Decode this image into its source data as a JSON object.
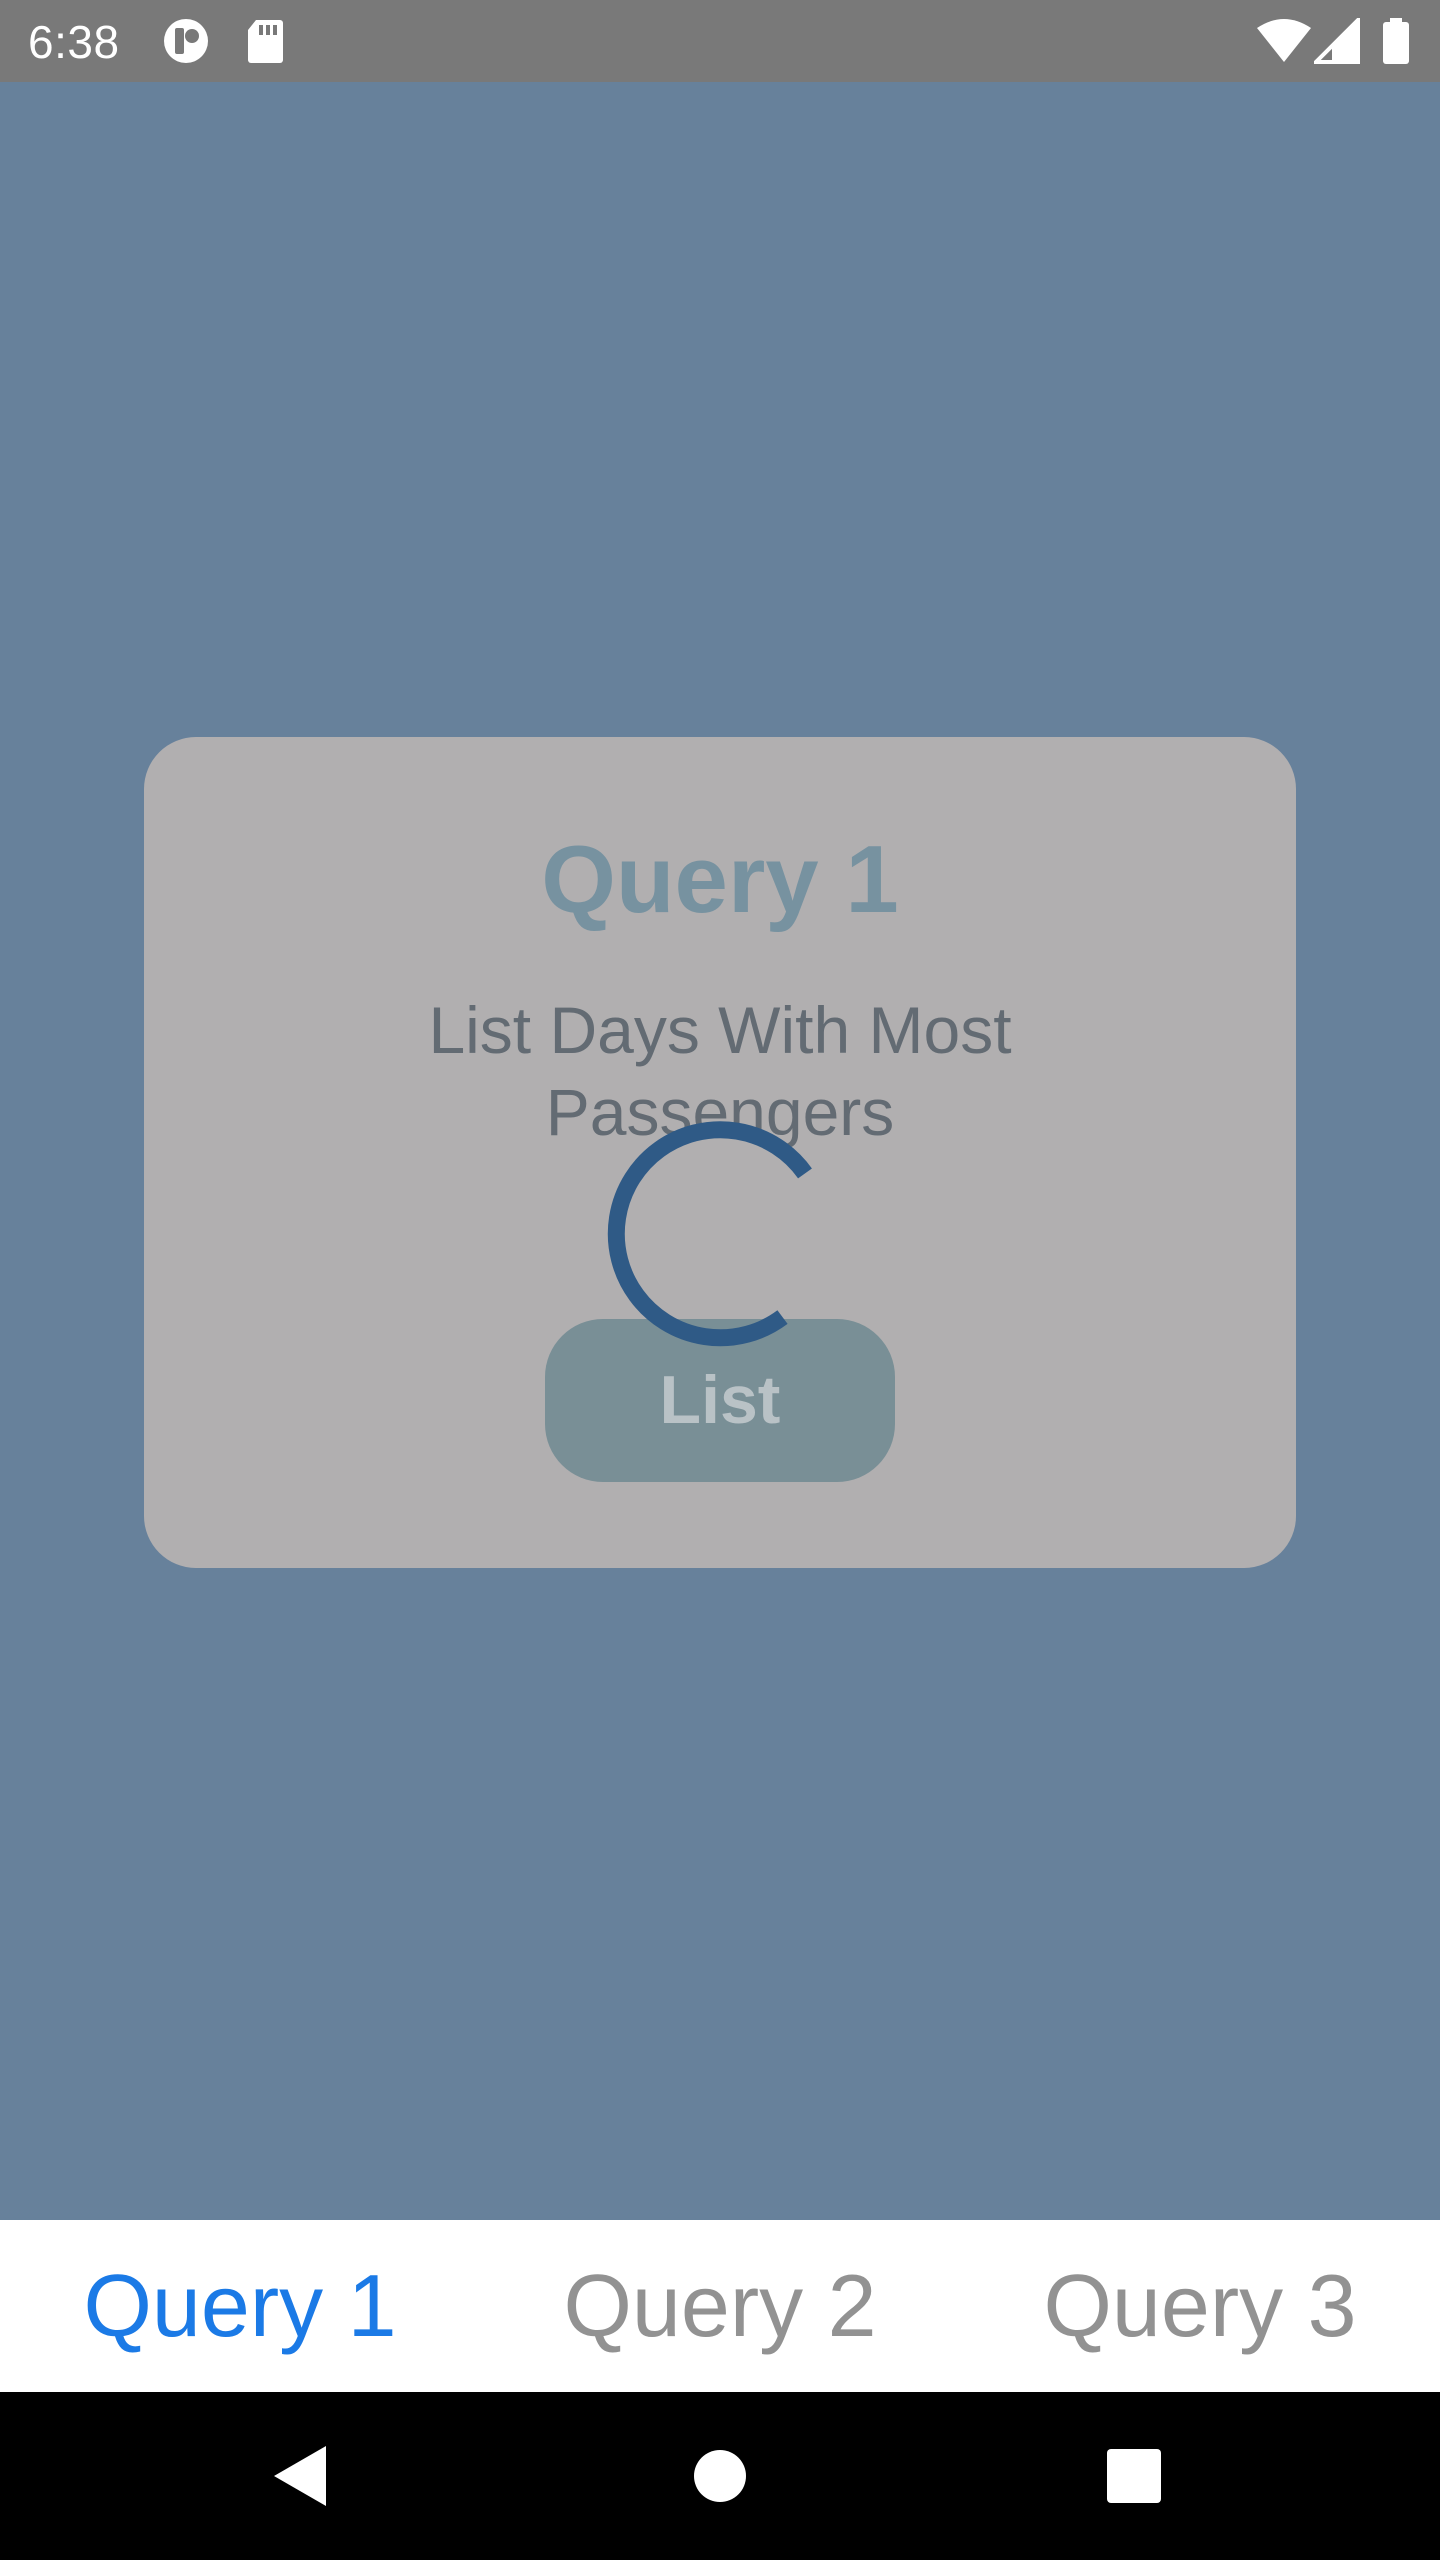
{
  "status_bar": {
    "time": "6:38",
    "icons": [
      "app-notification-icon",
      "sd-card-icon",
      "wifi-icon",
      "cellular-signal-icon",
      "battery-icon"
    ]
  },
  "card": {
    "title": "Query 1",
    "description": "List Days With Most Passengers",
    "button_label": "List"
  },
  "loading": {
    "indicator": "spinner-icon"
  },
  "tabs": [
    {
      "label": "Query 1",
      "active": true
    },
    {
      "label": "Query 2",
      "active": false
    },
    {
      "label": "Query 3",
      "active": false
    }
  ],
  "nav_bar": {
    "icons": [
      "back-icon",
      "home-icon",
      "recents-icon"
    ]
  },
  "colors": {
    "background_overlay": "#67819b",
    "card_background": "#b1afb0",
    "tab_active": "#1b7ae6",
    "tab_inactive": "#929292",
    "spinner": "#2f5a86"
  }
}
